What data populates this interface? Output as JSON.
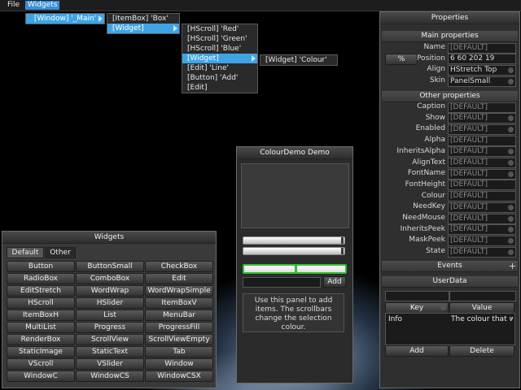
{
  "menubar": {
    "file": "File",
    "widgets": "Widgets"
  },
  "menus": {
    "level1": [
      "[Window] '_Main'"
    ],
    "level2": [
      "[ItemBox] 'Box'",
      "[Widget]"
    ],
    "level3": [
      "[HScroll] 'Red'",
      "[HScroll] 'Green'",
      "[HScroll] 'Blue'",
      "[Widget]",
      "[Edit] 'Line'",
      "[Button] 'Add'",
      "[Edit]"
    ],
    "level4": [
      "[Widget] 'Colour'"
    ]
  },
  "widgets_panel": {
    "title": "Widgets",
    "tabs": [
      "Default",
      "Other"
    ],
    "buttons": [
      [
        "Button",
        "ButtonSmall",
        "CheckBox"
      ],
      [
        "RadioBox",
        "ComboBox",
        "Edit"
      ],
      [
        "EditStretch",
        "WordWrap",
        "WordWrapSimple"
      ],
      [
        "HScroll",
        "HSlider",
        "ItemBoxV"
      ],
      [
        "ItemBoxH",
        "List",
        "MenuBar"
      ],
      [
        "MultiList",
        "Progress",
        "ProgressFill"
      ],
      [
        "RenderBox",
        "ScrollView",
        "ScrollViewEmpty"
      ],
      [
        "StaticImage",
        "StaticText",
        "Tab"
      ],
      [
        "VScroll",
        "VSlider",
        "Window"
      ],
      [
        "WindowC",
        "WindowCS",
        "WindowCSX"
      ]
    ]
  },
  "colour_demo": {
    "title": "ColourDemo Demo",
    "add_label": "Add",
    "info": "Use this panel to add items. The scrollbars change the selection colour."
  },
  "properties": {
    "title": "Properties",
    "main_header": "Main properties",
    "main": [
      {
        "label": "Name",
        "value": "[DEFAULT]",
        "type": "edit"
      },
      {
        "label": "Position",
        "value": "6 60 202 19",
        "type": "edit",
        "button": "%"
      },
      {
        "label": "Align",
        "value": "HStretch Top",
        "type": "combo"
      },
      {
        "label": "Skin",
        "value": "PanelSmall",
        "type": "combo"
      }
    ],
    "other_header": "Other properties",
    "other": [
      {
        "label": "Caption",
        "value": "[DEFAULT]",
        "type": "edit"
      },
      {
        "label": "Show",
        "value": "[DEFAULT]",
        "type": "combo"
      },
      {
        "label": "Enabled",
        "value": "[DEFAULT]",
        "type": "combo"
      },
      {
        "label": "Alpha",
        "value": "[DEFAULT]",
        "type": "edit"
      },
      {
        "label": "InheritsAlpha",
        "value": "[DEFAULT]",
        "type": "combo"
      },
      {
        "label": "AlignText",
        "value": "[DEFAULT]",
        "type": "combo"
      },
      {
        "label": "FontName",
        "value": "[DEFAULT]",
        "type": "combo"
      },
      {
        "label": "FontHeight",
        "value": "[DEFAULT]",
        "type": "edit"
      },
      {
        "label": "Colour",
        "value": "[DEFAULT]",
        "type": "edit"
      },
      {
        "label": "NeedKey",
        "value": "[DEFAULT]",
        "type": "combo"
      },
      {
        "label": "NeedMouse",
        "value": "[DEFAULT]",
        "type": "combo"
      },
      {
        "label": "InheritsPeek",
        "value": "[DEFAULT]",
        "type": "combo"
      },
      {
        "label": "MaskPeek",
        "value": "[DEFAULT]",
        "type": "combo"
      },
      {
        "label": "State",
        "value": "[DEFAULT]",
        "type": "combo"
      }
    ],
    "events_header": "Events",
    "userdata_header": "UserData",
    "userdata_cols": [
      "Key",
      "Value"
    ],
    "userdata_rows": [
      {
        "key": "Info",
        "value": "The colour that w"
      }
    ],
    "add_label": "Add",
    "delete_label": "Delete"
  },
  "icons": {
    "submenu": "chevron-right-icon",
    "expand": "plus-icon",
    "combo": "dropdown-icon"
  },
  "colors": {
    "accent": "#3fa4e6",
    "green": "#2fbf2f"
  }
}
